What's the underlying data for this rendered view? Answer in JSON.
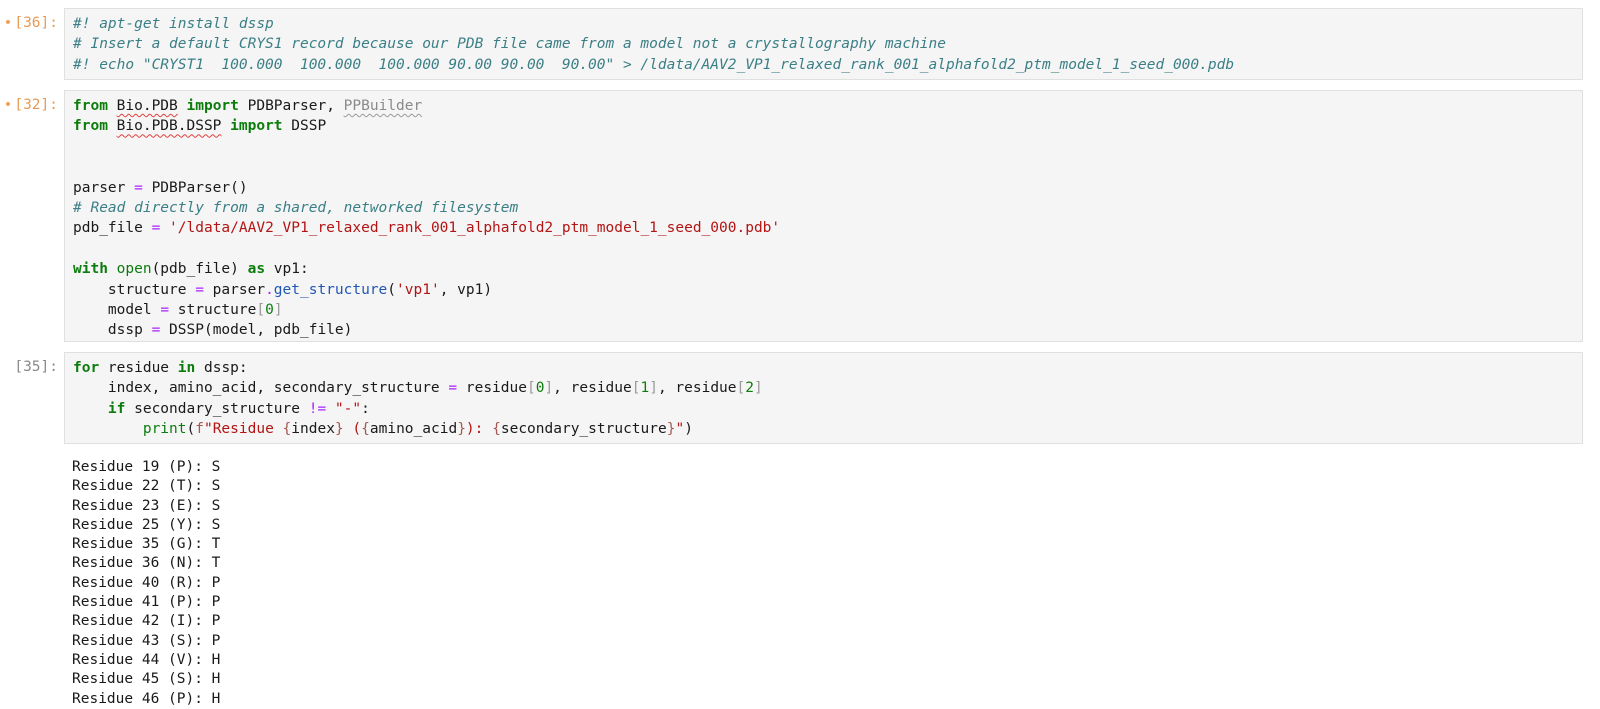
{
  "cells": [
    {
      "prompt": "[36]:",
      "modified": true,
      "lines": [
        [
          {
            "t": "#! apt-get install dssp",
            "c": "cm"
          }
        ],
        [
          {
            "t": "# Insert a default CRYS1 record because our PDB file came from a model not a crystallography machine",
            "c": "cm"
          }
        ],
        [
          {
            "t": "#! echo \"CRYST1  100.000  100.000  100.000 90.00 90.00  90.00\" > /ldata/AAV2_VP1_relaxed_rank_001_alphafold2_ptm_model_1_seed_000.pdb",
            "c": "cm"
          }
        ]
      ]
    },
    {
      "prompt": "[32]:",
      "modified": true,
      "lines": [
        [
          {
            "t": "from",
            "c": "kw"
          },
          {
            "t": " "
          },
          {
            "t": "Bio.PDB",
            "c": "squig"
          },
          {
            "t": " "
          },
          {
            "t": "import",
            "c": "kw"
          },
          {
            "t": " PDBParser, "
          },
          {
            "t": "PPBuilder",
            "c": "squig-grey"
          }
        ],
        [
          {
            "t": "from",
            "c": "kw"
          },
          {
            "t": " "
          },
          {
            "t": "Bio.PDB.DSSP",
            "c": "squig"
          },
          {
            "t": " "
          },
          {
            "t": "import",
            "c": "kw"
          },
          {
            "t": " DSSP"
          }
        ],
        [],
        [],
        [
          {
            "t": "parser "
          },
          {
            "t": "=",
            "c": "op"
          },
          {
            "t": " PDBParser()"
          }
        ],
        [
          {
            "t": "# Read directly from a shared, networked filesystem",
            "c": "cm"
          }
        ],
        [
          {
            "t": "pdb_file "
          },
          {
            "t": "=",
            "c": "op"
          },
          {
            "t": " "
          },
          {
            "t": "'/ldata/AAV2_VP1_relaxed_rank_001_alphafold2_ptm_model_1_seed_000.pdb'",
            "c": "st"
          }
        ],
        [],
        [
          {
            "t": "with",
            "c": "kw"
          },
          {
            "t": " "
          },
          {
            "t": "open",
            "c": "bi"
          },
          {
            "t": "(pdb_file) "
          },
          {
            "t": "as",
            "c": "kw"
          },
          {
            "t": " vp1:"
          }
        ],
        [
          {
            "t": "    structure "
          },
          {
            "t": "=",
            "c": "op"
          },
          {
            "t": " parser"
          },
          {
            "t": ".",
            "c": "op"
          },
          {
            "t": "get_structure",
            "c": "fn"
          },
          {
            "t": "("
          },
          {
            "t": "'vp1'",
            "c": "st"
          },
          {
            "t": ", vp1)"
          }
        ],
        [
          {
            "t": "    model "
          },
          {
            "t": "=",
            "c": "op"
          },
          {
            "t": " structure"
          },
          {
            "t": "[",
            "c": "br"
          },
          {
            "t": "0",
            "c": "num"
          },
          {
            "t": "]",
            "c": "br"
          }
        ],
        [
          {
            "t": "    dssp "
          },
          {
            "t": "=",
            "c": "op"
          },
          {
            "t": " DSSP(model, pdb_file)"
          }
        ]
      ]
    },
    {
      "prompt": "[35]:",
      "modified": false,
      "lines": [
        [
          {
            "t": "for",
            "c": "kw"
          },
          {
            "t": " residue "
          },
          {
            "t": "in",
            "c": "kw"
          },
          {
            "t": " dssp:"
          }
        ],
        [
          {
            "t": "    index, amino_acid, secondary_structure "
          },
          {
            "t": "=",
            "c": "op"
          },
          {
            "t": " residue"
          },
          {
            "t": "[",
            "c": "br"
          },
          {
            "t": "0",
            "c": "num"
          },
          {
            "t": "]",
            "c": "br"
          },
          {
            "t": ", residue"
          },
          {
            "t": "[",
            "c": "br"
          },
          {
            "t": "1",
            "c": "num"
          },
          {
            "t": "]",
            "c": "br"
          },
          {
            "t": ", residue"
          },
          {
            "t": "[",
            "c": "br"
          },
          {
            "t": "2",
            "c": "num"
          },
          {
            "t": "]",
            "c": "br"
          }
        ],
        [
          {
            "t": "    "
          },
          {
            "t": "if",
            "c": "kw"
          },
          {
            "t": " secondary_structure "
          },
          {
            "t": "!=",
            "c": "op"
          },
          {
            "t": " "
          },
          {
            "t": "\"-\"",
            "c": "st"
          },
          {
            "t": ":"
          }
        ],
        [
          {
            "t": "        "
          },
          {
            "t": "print",
            "c": "bi"
          },
          {
            "t": "("
          },
          {
            "t": "f",
            "c": "affix"
          },
          {
            "t": "\"Residue ",
            "c": "st"
          },
          {
            "t": "{",
            "c": "interp"
          },
          {
            "t": "index"
          },
          {
            "t": "}",
            "c": "interp"
          },
          {
            "t": " (",
            "c": "st"
          },
          {
            "t": "{",
            "c": "interp"
          },
          {
            "t": "amino_acid"
          },
          {
            "t": "}",
            "c": "interp"
          },
          {
            "t": "): ",
            "c": "st"
          },
          {
            "t": "{",
            "c": "interp"
          },
          {
            "t": "secondary_structure"
          },
          {
            "t": "}",
            "c": "interp"
          },
          {
            "t": "\"",
            "c": "st"
          },
          {
            "t": ")"
          }
        ]
      ]
    }
  ],
  "output": [
    "Residue 19 (P): S",
    "Residue 22 (T): S",
    "Residue 23 (E): S",
    "Residue 25 (Y): S",
    "Residue 35 (G): T",
    "Residue 36 (N): T",
    "Residue 40 (R): P",
    "Residue 41 (P): P",
    "Residue 42 (I): P",
    "Residue 43 (S): P",
    "Residue 44 (V): H",
    "Residue 45 (S): H",
    "Residue 46 (P): H"
  ]
}
